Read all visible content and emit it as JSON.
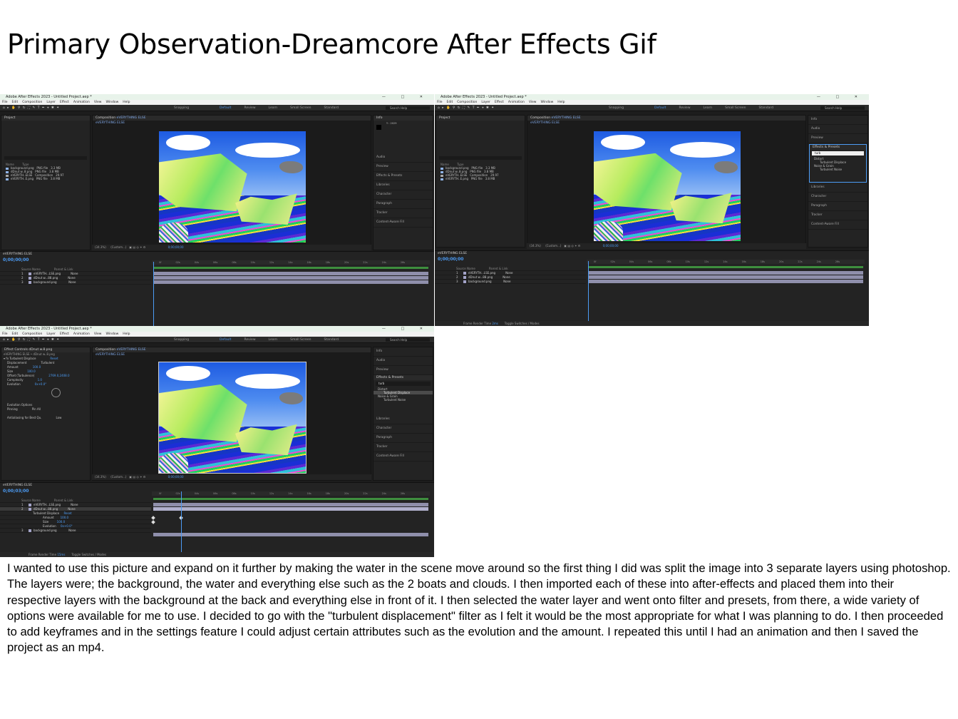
{
  "slide": {
    "title": "Primary Observation-Dreamcore After Effects Gif",
    "body": "I wanted to use this picture and expand on it further by making the water in the scene move around so the first thing I did was split the image into 3 separate layers using photoshop. The layers were; the background, the water and everything else such as the 2 boats and clouds. I then imported each of these into after-effects and placed them into their respective layers with the background at the back and everything else in front of it. I then selected the water layer and went onto filter and presets, from there, a wide variety of options were available for me to use. I decided to go with the \"turbulent displacement\" filter as I felt it would be the most appropriate for what I was planning to do. I then proceeded to add keyframes and in the settings feature I could adjust certain attributes such as the evolution and the amount. I repeated this until I had an animation and then I saved the project as an mp4."
  },
  "app": {
    "window_title": "Adobe After Effects 2023 - Untitled Project.aep *",
    "menu": [
      "File",
      "Edit",
      "Composition",
      "Layer",
      "Effect",
      "Animation",
      "View",
      "Window",
      "Help"
    ],
    "workspaces": [
      "Default",
      "Review",
      "Learn",
      "Small Screen",
      "Standard"
    ],
    "search_placeholder": "Search Help",
    "snapping": "Snapping",
    "project_panel": "Project",
    "composition_tab": "Composition",
    "comp_name": "eVERYTHING ELSE",
    "comp_label": "eVERYTHING ELSE",
    "zoom": "(34.3%)",
    "resolution": "(Custom...)",
    "timecode_display": "0;00;00;00",
    "side_panels": [
      "Info",
      "Audio",
      "Preview",
      "Effects & Presets",
      "Libraries",
      "Character",
      "Paragraph",
      "Tracker",
      "Content-Aware Fill"
    ],
    "project_columns": [
      "Name",
      "Type",
      "Size",
      "Frame R..."
    ],
    "project_items": [
      {
        "name": "background.png",
        "type": "PNG file",
        "size": "3.3 MB"
      },
      {
        "name": "dDnut w..8.png",
        "type": "PNG file",
        "size": "3.8 MB"
      },
      {
        "name": "eVERYTH..ELSE",
        "type": "Composition",
        "size": "",
        "fps": "29.97"
      },
      {
        "name": "eVERYTH..E.png",
        "type": "PNG file",
        "size": "3.8 MB"
      }
    ],
    "bpc": "8 bpc",
    "layers": [
      {
        "num": "1",
        "name": "eVERYTH...LSE.png"
      },
      {
        "num": "2",
        "name": "dDnut w...88.png"
      },
      {
        "num": "3",
        "name": "background.png"
      }
    ],
    "layer_columns": [
      "Source Name",
      "Parent & Link"
    ],
    "parent_value": "None",
    "ruler_ticks": [
      "0f",
      "02s",
      "04s",
      "06s",
      "08s",
      "10s",
      "12s",
      "14s",
      "16s",
      "18s",
      "20s",
      "22s",
      "24s",
      "26s",
      "28s",
      "30s"
    ],
    "timecode_1": "0;00;00;00",
    "timecode_3": "0;00;03;00",
    "frame_render_label": "Frame Render Time",
    "frame_render_time_2": "2ms",
    "frame_render_time_3": "15ms",
    "toggle_label": "Toggle Switches / Modes",
    "effects_search": "turb",
    "effects_results": [
      "Distort",
      "Turbulent Displace",
      "Noise & Grain",
      "Turbulent Noise"
    ],
    "info_values": [
      "R :",
      "G :",
      "B :",
      "A : 0",
      "X : 454",
      "Y : 2029"
    ],
    "effect_controls_tab": "Effect Controls dDnut w.8.png",
    "effect_controls": {
      "path": "eVERYTHING ELSE • dDnut w..8.png",
      "effect": "Turbulent Displace",
      "reset": "Reset",
      "props": [
        {
          "name": "Displacement",
          "value": "Turbulent"
        },
        {
          "name": "Amount",
          "value": "100.0"
        },
        {
          "name": "Size",
          "value": "100.0"
        },
        {
          "name": "Offset (Turbulence)",
          "value": "2769.0,2408.0"
        },
        {
          "name": "Complexity",
          "value": "1.0"
        },
        {
          "name": "Evolution",
          "value": "0x+0.0°"
        },
        {
          "name": "Evolution Options",
          "value": ""
        },
        {
          "name": "Pinning",
          "value": "Pin All"
        },
        {
          "name": "Antialiasing for Best Qu.",
          "value": "Low"
        }
      ]
    },
    "sub_props": [
      {
        "name": "Turbulent Displace",
        "value": "Reset"
      },
      {
        "name": "Amount",
        "value": "100.0"
      },
      {
        "name": "Size",
        "value": "100.0"
      },
      {
        "name": "Evolution",
        "value": "0x+0.0°"
      }
    ]
  },
  "colors": {
    "accent": "#4c9cf5",
    "panel_bg": "#232323",
    "titlebar": "#e8f3ea"
  }
}
